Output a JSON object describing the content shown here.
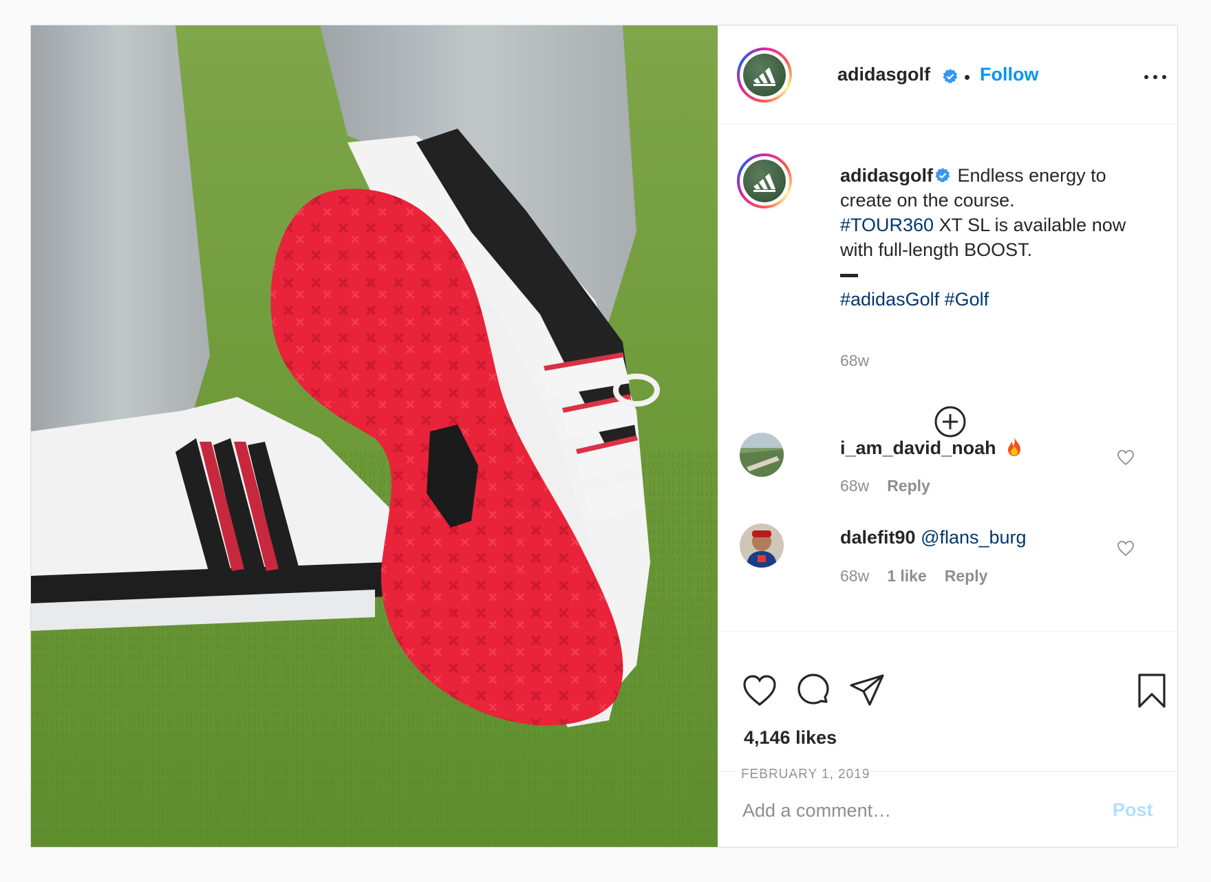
{
  "post": {
    "username": "adidasgolf",
    "follow_label": "Follow",
    "separator": "•",
    "caption": {
      "username": "adidasgolf",
      "text_1": "Endless energy to create on the course.",
      "hashtag_1": "#TOUR360",
      "text_2": " XT SL is available now with full-length BOOST.",
      "hashtag_2": "#adidasGolf",
      "hashtag_3": "#Golf",
      "time": "68w"
    },
    "comments": [
      {
        "username": "i_am_david_noah",
        "text": "",
        "emoji": "fire-emoji",
        "time": "68w",
        "likes": "",
        "reply": "Reply"
      },
      {
        "username": "dalefit90",
        "text": "@flans_burg",
        "time": "68w",
        "likes": "1 like",
        "reply": "Reply"
      }
    ],
    "likes": "4,146 likes",
    "date": "FEBRUARY 1, 2019",
    "comment_placeholder": "Add a comment…",
    "post_label": "Post",
    "icons": [
      "verified-badge",
      "more-options-icon",
      "load-more-comments-icon",
      "heart-icon",
      "comment-icon",
      "share-icon",
      "bookmark-icon"
    ],
    "colors": {
      "link_blue": "#0095f6",
      "hashtag": "#00376b",
      "muted": "#8e8e8e",
      "post_disabled": "#b2dffc",
      "sole_red": "#e8233a"
    }
  }
}
